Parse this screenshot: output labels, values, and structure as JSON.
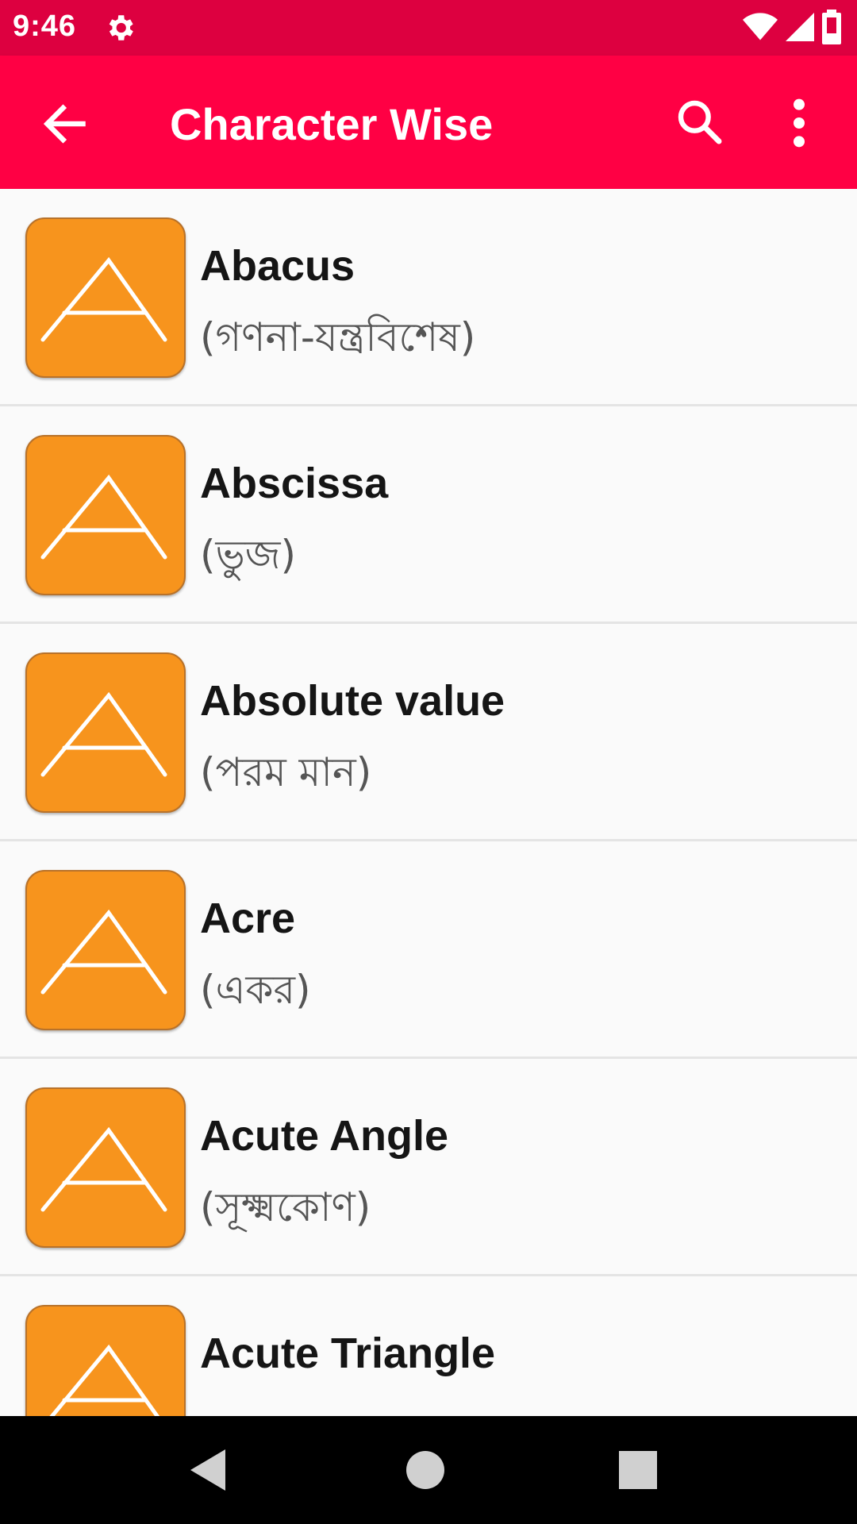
{
  "status_bar": {
    "time": "9:46"
  },
  "app_bar": {
    "title": "Character Wise"
  },
  "tile_letter_icon": "letter-a-icon",
  "items": [
    {
      "term": "Abacus",
      "meaning": "(গণনা-যন্ত্রবিশেষ)"
    },
    {
      "term": "Abscissa",
      "meaning": "(ভুজ)"
    },
    {
      "term": "Absolute value",
      "meaning": "(পরম মান)"
    },
    {
      "term": "Acre",
      "meaning": "(একর)"
    },
    {
      "term": "Acute Angle",
      "meaning": "(সূক্ষ্মকোণ)"
    },
    {
      "term": "Acute Triangle",
      "meaning": ""
    }
  ],
  "colors": {
    "status_bar": "#dd0040",
    "app_bar": "#ff0044",
    "tile": "#f7941d"
  }
}
